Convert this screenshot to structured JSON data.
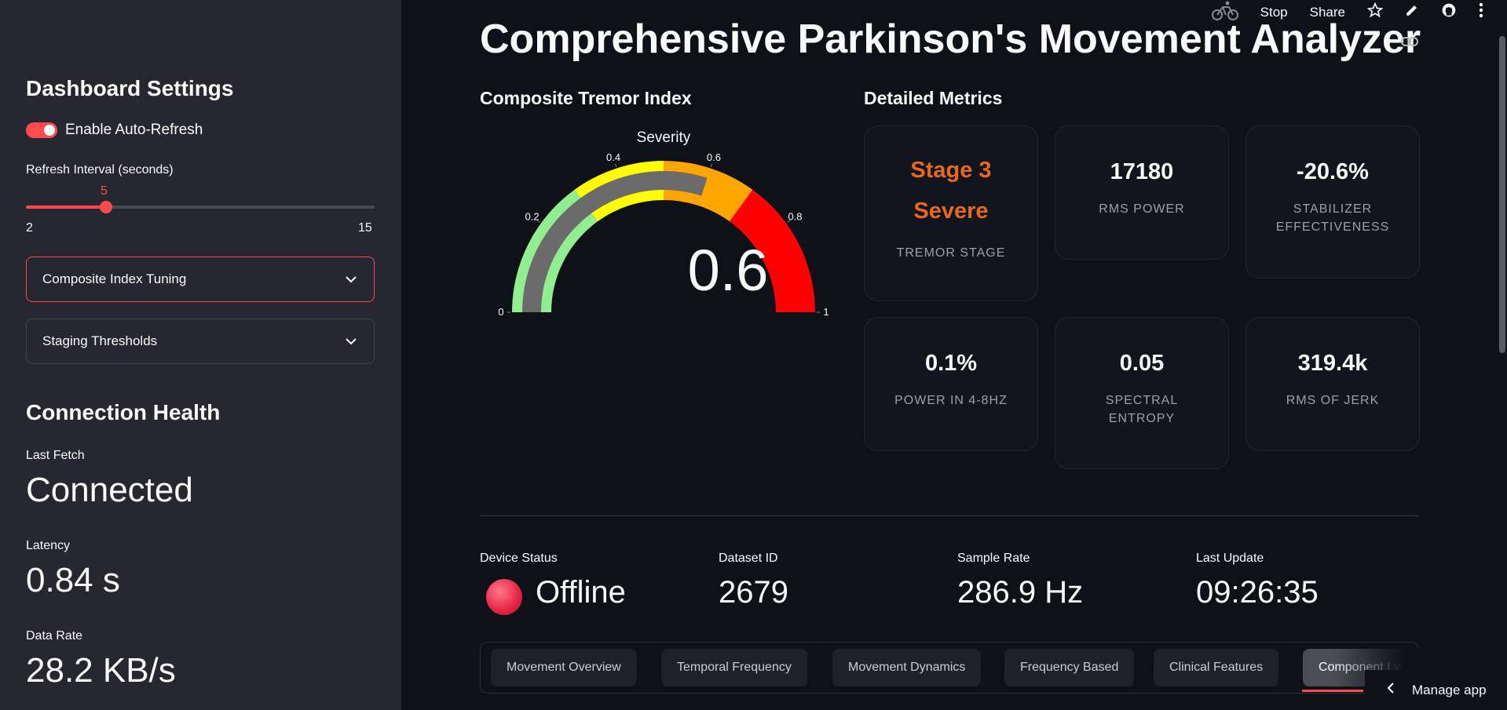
{
  "sidebar": {
    "settings_title": "Dashboard Settings",
    "auto_refresh_label": "Enable Auto-Refresh",
    "auto_refresh_on": true,
    "refresh_label": "Refresh Interval (seconds)",
    "refresh_value": "5",
    "refresh_min": "2",
    "refresh_max": "15",
    "expander_tuning": "Composite Index Tuning",
    "expander_thresholds": "Staging Thresholds",
    "connection_title": "Connection Health",
    "last_fetch_label": "Last Fetch",
    "last_fetch_value": "Connected",
    "latency_label": "Latency",
    "latency_value": "0.84 s",
    "data_rate_label": "Data Rate",
    "data_rate_value": "28.2 KB/s"
  },
  "topbar": {
    "stop": "Stop",
    "share": "Share",
    "icons": [
      "running-cyclist-icon",
      "star-icon",
      "pencil-icon",
      "github-icon",
      "more-vertical-icon"
    ]
  },
  "main": {
    "title": "Comprehensive Parkinson's Movement Analyzer",
    "gauge_heading": "Composite Tremor Index",
    "metrics_heading": "Detailed Metrics"
  },
  "gauge": {
    "title": "Severity",
    "value": 0.6,
    "value_text": "0.6",
    "min": 0,
    "max": 1,
    "ticks": [
      "0",
      "0.2",
      "0.4",
      "0.6",
      "0.8",
      "1"
    ],
    "bands": [
      {
        "from": 0,
        "to": 0.3,
        "color": "#90ee90"
      },
      {
        "from": 0.3,
        "to": 0.5,
        "color": "#ffff00"
      },
      {
        "from": 0.5,
        "to": 0.7,
        "color": "#ffa500"
      },
      {
        "from": 0.7,
        "to": 1,
        "color": "#ff0000"
      }
    ],
    "bar_color": "#6b6b6b"
  },
  "metrics": [
    {
      "value": "Stage 3",
      "value2": "Severe",
      "label": "TREMOR STAGE"
    },
    {
      "value": "17180",
      "label": "RMS POWER"
    },
    {
      "value": "-20.6%",
      "label": "STABILIZER EFFECTIVENESS"
    },
    {
      "value": "0.1%",
      "label": "POWER IN 4-8HZ"
    },
    {
      "value": "0.05",
      "label": "SPECTRAL ENTROPY"
    },
    {
      "value": "319.4k",
      "label": "RMS OF JERK"
    }
  ],
  "device": {
    "status_label": "Device Status",
    "status_value": "Offline",
    "dataset_label": "Dataset ID",
    "dataset_value": "2679",
    "sample_label": "Sample Rate",
    "sample_value": "286.9 Hz",
    "update_label": "Last Update",
    "update_value": "09:26:35"
  },
  "tabs": [
    "Movement Overview",
    "Temporal Frequency",
    "Movement Dynamics",
    "Frequency Based",
    "Clinical Features",
    "Component Lw"
  ],
  "manage_app": "Manage app"
}
